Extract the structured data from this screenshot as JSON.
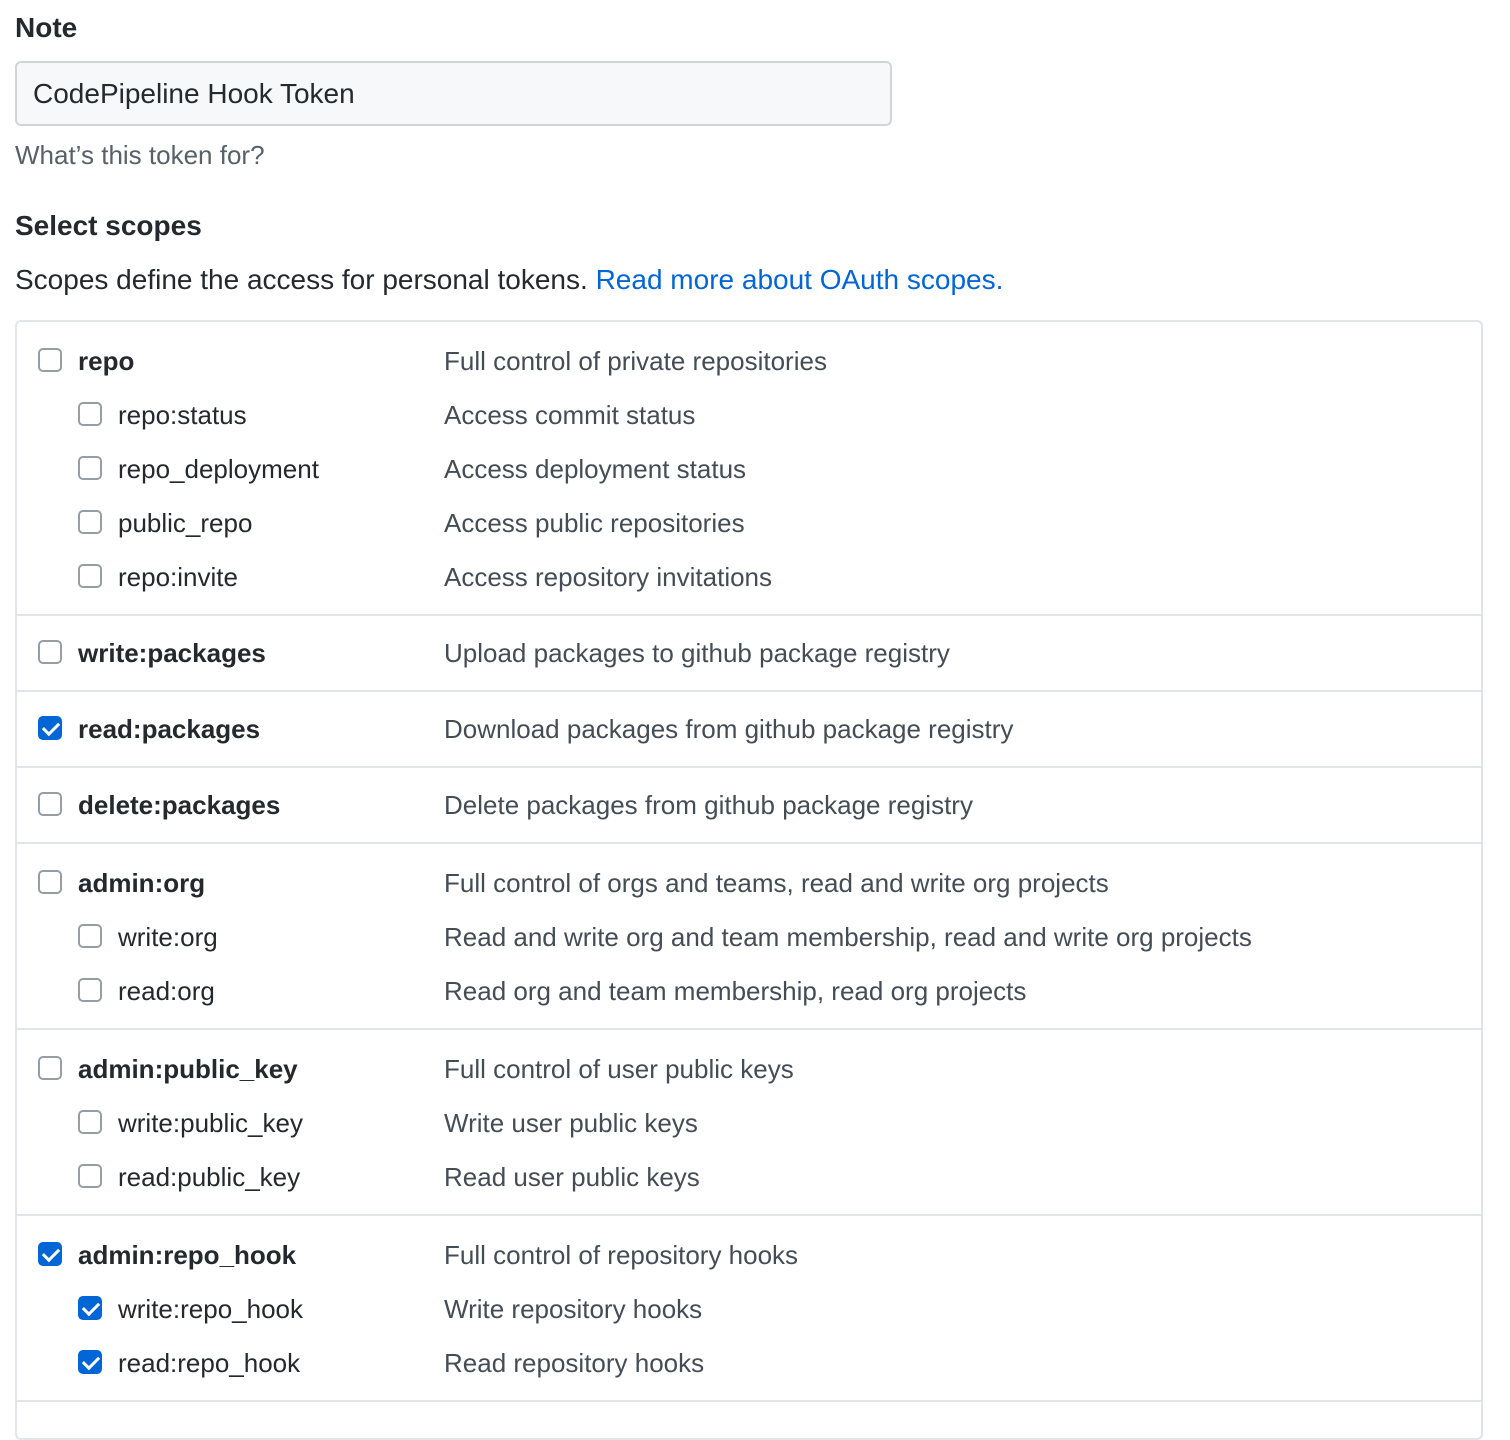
{
  "note": {
    "label": "Note",
    "value": "CodePipeline Hook Token",
    "hint": "What’s this token for?"
  },
  "scopes": {
    "title": "Select scopes",
    "description": "Scopes define the access for personal tokens.",
    "link": "Read more about OAuth scopes.",
    "groups": [
      {
        "name": "repo",
        "desc": "Full control of private repositories",
        "checked": false,
        "children": [
          {
            "name": "repo:status",
            "desc": "Access commit status",
            "checked": false
          },
          {
            "name": "repo_deployment",
            "desc": "Access deployment status",
            "checked": false
          },
          {
            "name": "public_repo",
            "desc": "Access public repositories",
            "checked": false
          },
          {
            "name": "repo:invite",
            "desc": "Access repository invitations",
            "checked": false
          }
        ]
      },
      {
        "name": "write:packages",
        "desc": "Upload packages to github package registry",
        "checked": false,
        "children": []
      },
      {
        "name": "read:packages",
        "desc": "Download packages from github package registry",
        "checked": true,
        "children": []
      },
      {
        "name": "delete:packages",
        "desc": "Delete packages from github package registry",
        "checked": false,
        "children": []
      },
      {
        "name": "admin:org",
        "desc": "Full control of orgs and teams, read and write org projects",
        "checked": false,
        "children": [
          {
            "name": "write:org",
            "desc": "Read and write org and team membership, read and write org projects",
            "checked": false
          },
          {
            "name": "read:org",
            "desc": "Read org and team membership, read org projects",
            "checked": false
          }
        ]
      },
      {
        "name": "admin:public_key",
        "desc": "Full control of user public keys",
        "checked": false,
        "children": [
          {
            "name": "write:public_key",
            "desc": "Write user public keys",
            "checked": false
          },
          {
            "name": "read:public_key",
            "desc": "Read user public keys",
            "checked": false
          }
        ]
      },
      {
        "name": "admin:repo_hook",
        "desc": "Full control of repository hooks",
        "checked": true,
        "children": [
          {
            "name": "write:repo_hook",
            "desc": "Write repository hooks",
            "checked": true
          },
          {
            "name": "read:repo_hook",
            "desc": "Read repository hooks",
            "checked": true
          }
        ]
      }
    ]
  }
}
